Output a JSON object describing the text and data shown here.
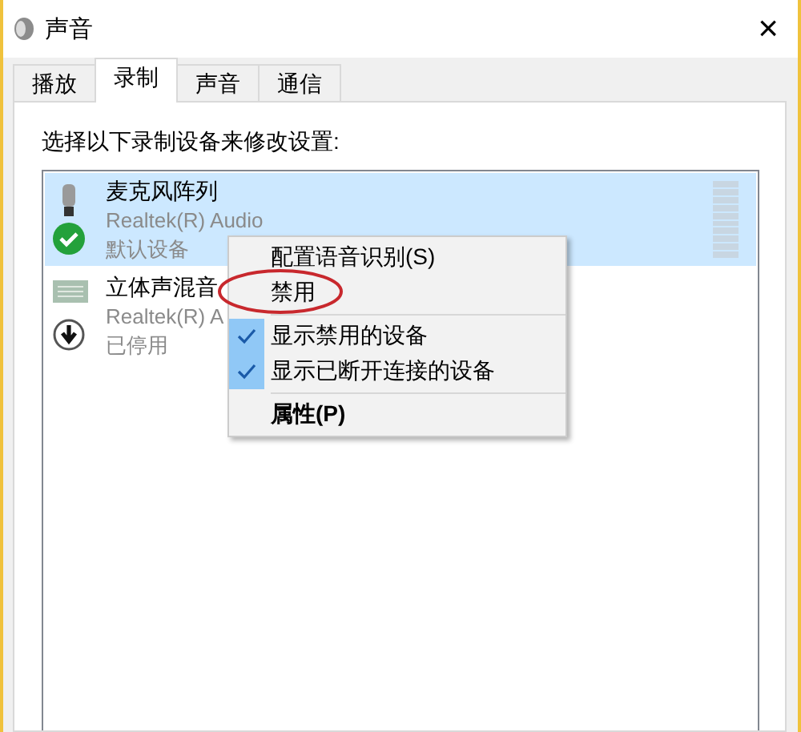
{
  "window": {
    "title": "声音",
    "close": "×"
  },
  "tabs": [
    {
      "label": "播放",
      "selected": false
    },
    {
      "label": "录制",
      "selected": true
    },
    {
      "label": "声音",
      "selected": false
    },
    {
      "label": "通信",
      "selected": false
    }
  ],
  "prompt": "选择以下录制设备来修改设置:",
  "devices": [
    {
      "name": "麦克风阵列",
      "driver": "Realtek(R) Audio",
      "status": "默认设备",
      "kind": "default",
      "selected": true
    },
    {
      "name": "立体声混音",
      "driver": "Realtek(R) A",
      "status": "已停用",
      "kind": "disabled",
      "selected": false
    }
  ],
  "context_menu": [
    {
      "kind": "item",
      "label": "配置语音识别(S)",
      "checked": false,
      "default": false,
      "circled": false
    },
    {
      "kind": "item",
      "label": "禁用",
      "checked": false,
      "default": false,
      "circled": true
    },
    {
      "kind": "separator"
    },
    {
      "kind": "item",
      "label": "显示禁用的设备",
      "checked": true,
      "default": false,
      "circled": false
    },
    {
      "kind": "item",
      "label": "显示已断开连接的设备",
      "checked": true,
      "default": false,
      "circled": false
    },
    {
      "kind": "separator"
    },
    {
      "kind": "item",
      "label": "属性(P)",
      "checked": false,
      "default": true,
      "circled": false
    }
  ]
}
